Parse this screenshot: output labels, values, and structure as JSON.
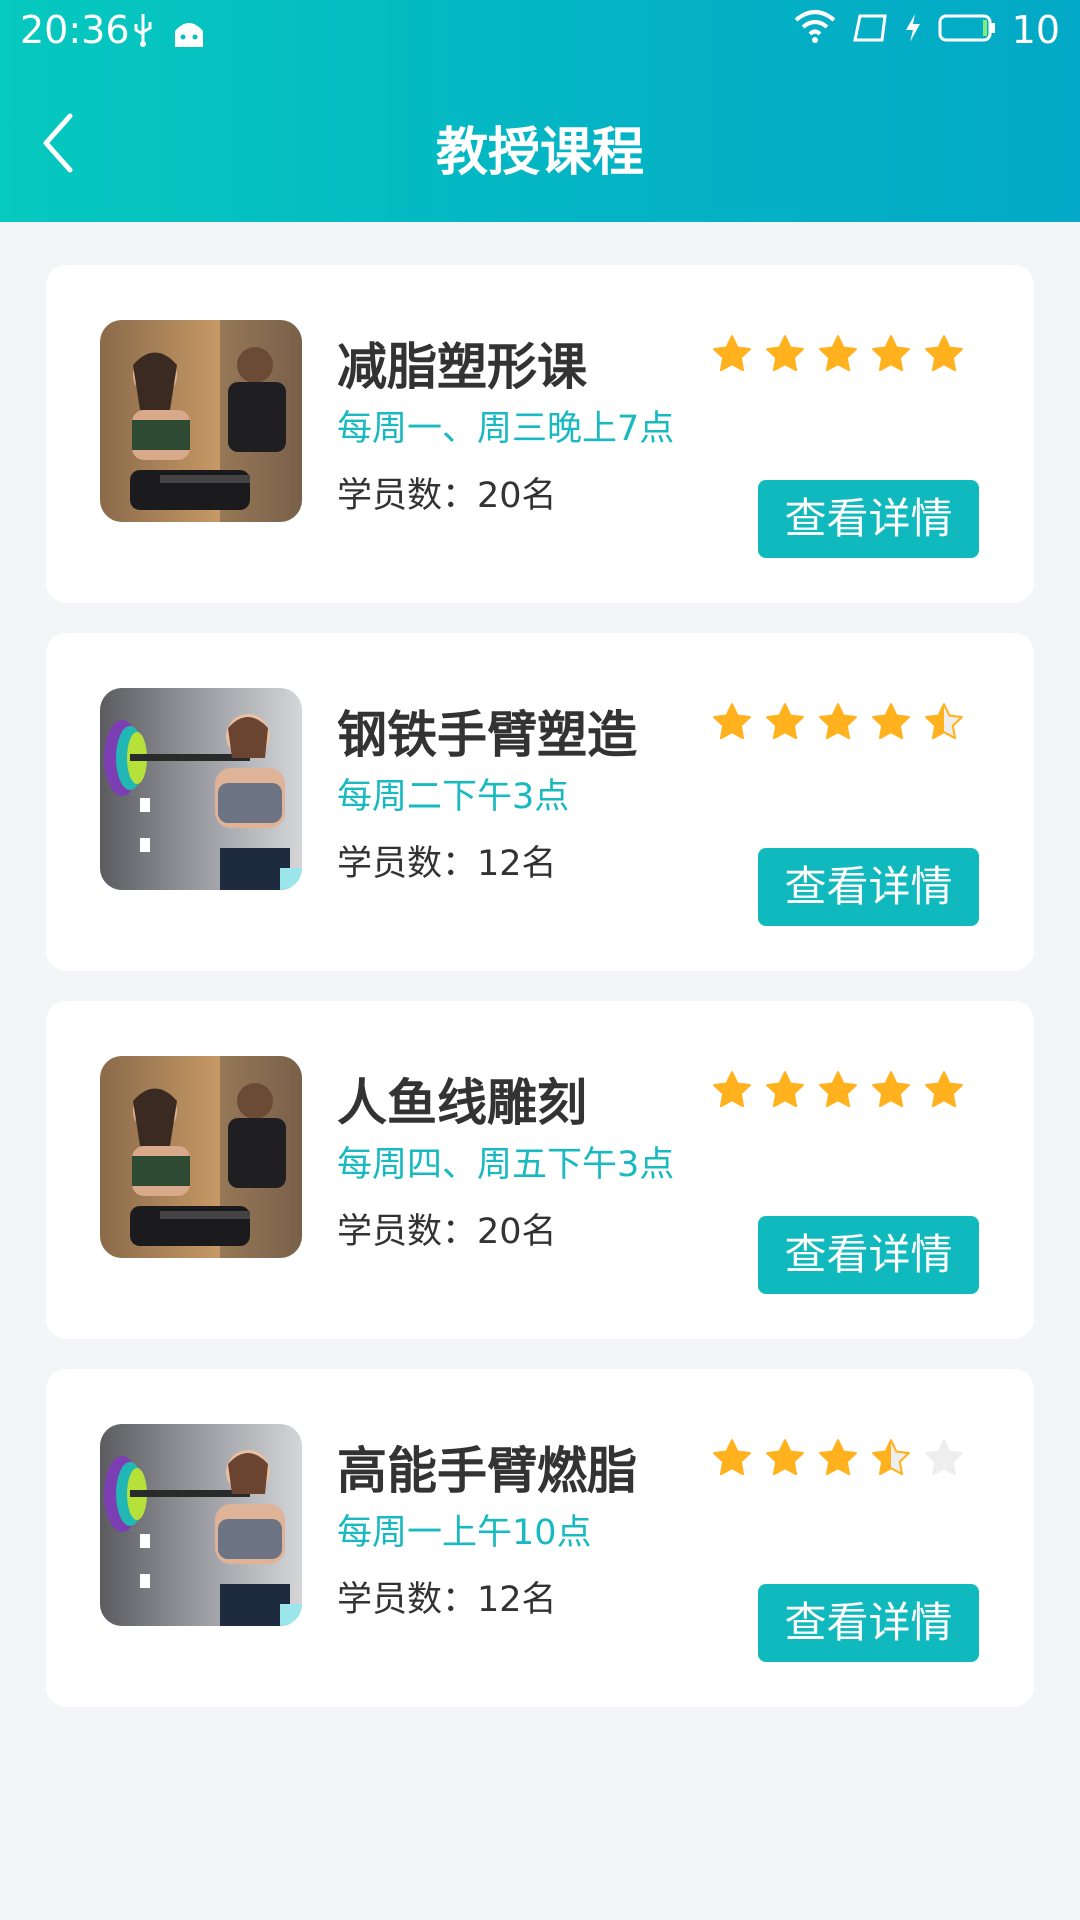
{
  "status_bar": {
    "time": "20:36",
    "battery": "10"
  },
  "nav": {
    "title": "教授课程",
    "back_icon": "chevron-left-icon"
  },
  "colors": {
    "accent": "#10b9bd",
    "schedule_text": "#18b9c0",
    "star_filled": "#ffb21e",
    "star_empty": "#eeeeee"
  },
  "courses": [
    {
      "name": "减脂塑形课",
      "schedule": "每周一、周三晚上7点",
      "students": "学员数：20名",
      "rating": 5,
      "button": "查看详情",
      "image": "rowing-workout-photo"
    },
    {
      "name": "钢铁手臂塑造",
      "schedule": "每周二下午3点",
      "students": "学员数：12名",
      "rating": 4.5,
      "button": "查看详情",
      "image": "barbell-workout-photo"
    },
    {
      "name": "人鱼线雕刻",
      "schedule": "每周四、周五下午3点",
      "students": "学员数：20名",
      "rating": 5,
      "button": "查看详情",
      "image": "rowing-workout-photo"
    },
    {
      "name": "高能手臂燃脂",
      "schedule": "每周一上午10点",
      "students": "学员数：12名",
      "rating": 3.5,
      "button": "查看详情",
      "image": "barbell-workout-photo"
    }
  ]
}
